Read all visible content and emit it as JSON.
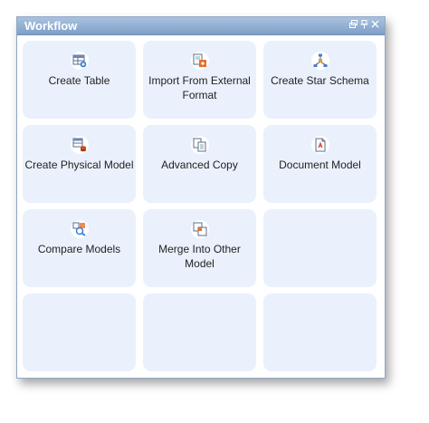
{
  "window": {
    "title": "Workflow",
    "controls": [
      "restore-icon",
      "pin-icon",
      "close-icon"
    ]
  },
  "tiles": [
    {
      "label": "Create Table",
      "icon": "table-add-icon"
    },
    {
      "label": "Import From External Format",
      "icon": "import-icon"
    },
    {
      "label": "Create Star Schema",
      "icon": "star-schema-icon"
    },
    {
      "label": "Create Physical Model",
      "icon": "physical-model-icon"
    },
    {
      "label": "Advanced Copy",
      "icon": "copy-icon"
    },
    {
      "label": "Document Model",
      "icon": "document-icon"
    },
    {
      "label": "Compare Models",
      "icon": "compare-icon"
    },
    {
      "label": "Merge Into Other Model",
      "icon": "merge-icon"
    },
    {
      "label": "",
      "icon": ""
    },
    {
      "label": "",
      "icon": ""
    },
    {
      "label": "",
      "icon": ""
    },
    {
      "label": "",
      "icon": ""
    }
  ]
}
